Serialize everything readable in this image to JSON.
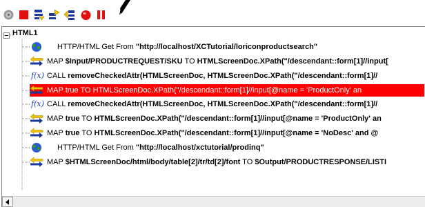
{
  "toolbar": {
    "buttons": [
      {
        "name": "execute-gear-button",
        "icon": "gear-icon"
      },
      {
        "name": "stop-button",
        "icon": "stop-square-icon"
      },
      {
        "name": "step-into-button",
        "icon": "step-into-icon"
      },
      {
        "name": "step-over-button",
        "icon": "step-over-icon"
      },
      {
        "name": "step-out-button",
        "icon": "step-out-icon"
      },
      {
        "name": "breakpoint-button",
        "icon": "breakpoint-icon"
      },
      {
        "name": "pause-button",
        "icon": "pause-icon"
      }
    ]
  },
  "tree": {
    "root": {
      "label": "HTML1"
    },
    "nodes": [
      {
        "type": "http",
        "icon": "globe-icon",
        "parts": [
          {
            "t": "HTTP/HTML Get From "
          },
          {
            "t": "\"http://localhost/XCTutorial/loriconproductsearch\"",
            "b": true
          }
        ]
      },
      {
        "type": "map",
        "icon": "map-arrows-icon",
        "parts": [
          {
            "t": "MAP "
          },
          {
            "t": "$Input/PRODUCTREQUEST/SKU",
            "b": true
          },
          {
            "t": " TO "
          },
          {
            "t": "HTMLScreenDoc.XPath(\"/descendant::form[1]//input[",
            "b": true
          }
        ]
      },
      {
        "type": "call",
        "icon": "function-icon",
        "parts": [
          {
            "t": "CALL "
          },
          {
            "t": "removeCheckedAttr(HTMLScreenDoc, HTMLScreenDoc.XPath(\"/descendant::form[1]//",
            "b": true
          }
        ]
      },
      {
        "type": "map",
        "icon": "map-arrows-icon",
        "selected": true,
        "parts": [
          {
            "t": "MAP true TO HTMLScreenDoc.XPath(\"/descendant::form[1]//input[@name = 'ProductOnly' an"
          }
        ]
      },
      {
        "type": "call",
        "icon": "function-icon",
        "parts": [
          {
            "t": "CALL "
          },
          {
            "t": "removeCheckedAttr(HTMLScreenDoc, HTMLScreenDoc.XPath(\"/descendant::form[1]//",
            "b": true
          }
        ]
      },
      {
        "type": "map",
        "icon": "map-arrows-icon",
        "parts": [
          {
            "t": "MAP "
          },
          {
            "t": "true",
            "b": true
          },
          {
            "t": " TO "
          },
          {
            "t": "HTMLScreenDoc.XPath(\"/descendant::form[1]//input[@name = 'ProductOnly' an",
            "b": true
          }
        ]
      },
      {
        "type": "map",
        "icon": "map-arrows-icon",
        "parts": [
          {
            "t": "MAP "
          },
          {
            "t": "true",
            "b": true
          },
          {
            "t": " TO "
          },
          {
            "t": "HTMLScreenDoc.XPath(\"/descendant::form[1]//input[@name = 'NoDesc' and @",
            "b": true
          }
        ]
      },
      {
        "type": "http",
        "icon": "globe-icon",
        "parts": [
          {
            "t": "HTTP/HTML Get From "
          },
          {
            "t": "\"http://localhost/xctutorial/prodinq\"",
            "b": true
          }
        ]
      },
      {
        "type": "map",
        "icon": "map-arrows-icon",
        "parts": [
          {
            "t": "MAP "
          },
          {
            "t": "$HTMLScreenDoc/html/body/table[2]/tr/td[2]/font",
            "b": true
          },
          {
            "t": " TO "
          },
          {
            "t": "$Output/PRODUCTRESPONSE/LISTI",
            "b": true
          }
        ]
      }
    ]
  },
  "colors": {
    "selected_bg": "#ff0000",
    "selected_fg": "#ffffff",
    "icon_blue": "#1a3aa0",
    "icon_yellow": "#f2c200"
  }
}
